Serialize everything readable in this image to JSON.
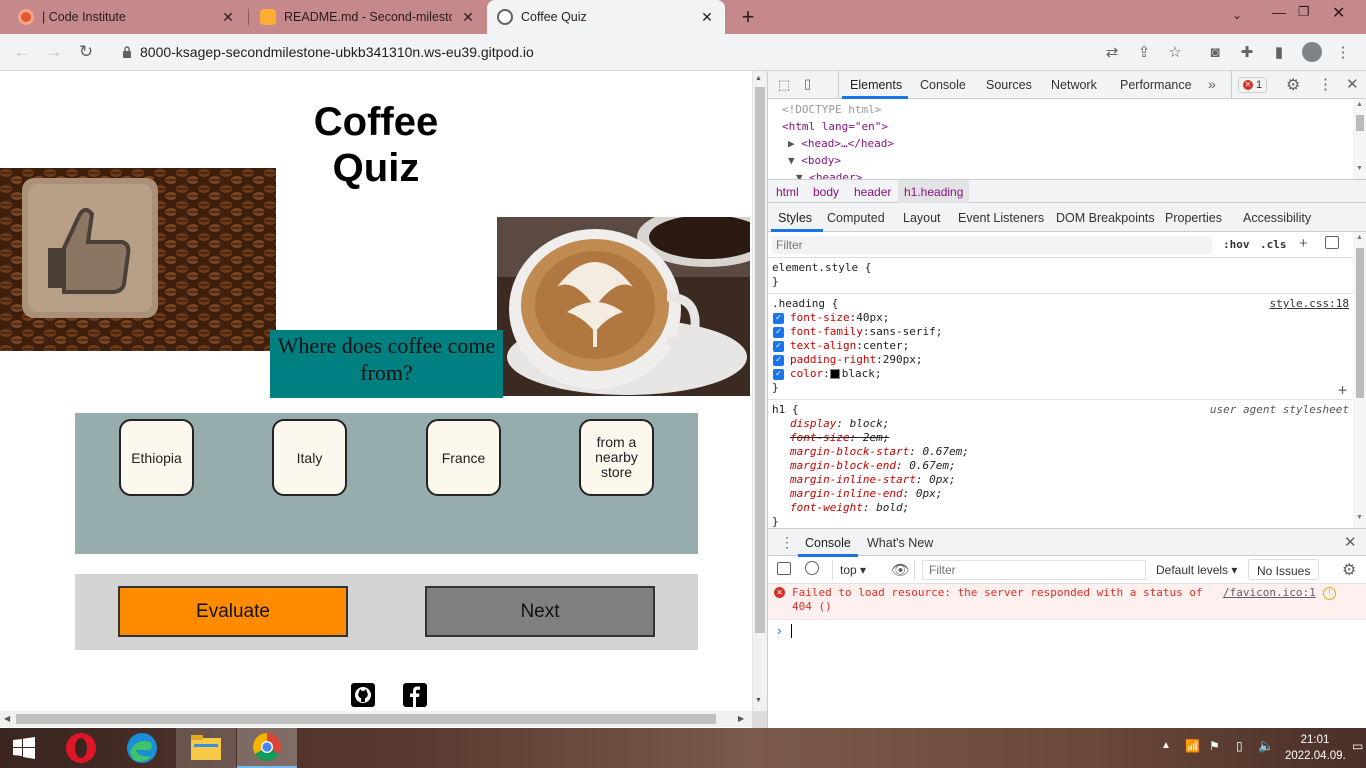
{
  "browser": {
    "tabs": [
      {
        "title": "| Code Institute",
        "active": false
      },
      {
        "title": "README.md - Second-milestone",
        "active": false
      },
      {
        "title": "Coffee Quiz",
        "active": true
      }
    ],
    "new_tab": "+",
    "url": "8000-ksagep-secondmilestone-ubkb341310n.ws-eu39.gitpod.io"
  },
  "quiz": {
    "heading_line1": "Coffee",
    "heading_line2": "Quiz",
    "question": "Where does coffee come from?",
    "answers": [
      "Ethiopia",
      "Italy",
      "France",
      "from a nearby store"
    ],
    "evaluate_label": "Evaluate",
    "next_label": "Next",
    "colors": {
      "question_bg": "#008080",
      "answers_bg": "#97acad",
      "evaluate_bg": "#ff8c00",
      "next_bg": "#808080",
      "controls_bg": "#d3d3d3"
    }
  },
  "devtools": {
    "main_tabs": [
      "Elements",
      "Console",
      "Sources",
      "Network",
      "Performance"
    ],
    "more_tabs": "»",
    "error_count": "1",
    "dom_lines": [
      "<!DOCTYPE html>",
      "<html lang=\"en\">",
      "<head>…</head>",
      "<body>",
      "<header>"
    ],
    "breadcrumbs": [
      "html",
      "body",
      "header",
      "h1.heading"
    ],
    "style_tabs": [
      "Styles",
      "Computed",
      "Layout",
      "Event Listeners",
      "DOM Breakpoints",
      "Properties",
      "Accessibility"
    ],
    "filter_placeholder": "Filter",
    "hov": ":hov",
    "cls": ".cls",
    "element_style_open": "element.style {",
    "close_brace": "}",
    "heading_rule": {
      "selector": ".heading {",
      "source": "style.css:18",
      "props": [
        {
          "name": "font-size",
          "value": "40px;"
        },
        {
          "name": "font-family",
          "value": "sans-serif;"
        },
        {
          "name": "text-align",
          "value": "center;"
        },
        {
          "name": "padding-right",
          "value": "290px;"
        },
        {
          "name": "color",
          "value": "black;"
        }
      ]
    },
    "h1_rule": {
      "selector": "h1 {",
      "source": "user agent stylesheet",
      "props": [
        {
          "name": "display",
          "value": "block;",
          "struck": false
        },
        {
          "name": "font-size",
          "value": "2em;",
          "struck": true
        },
        {
          "name": "margin-block-start",
          "value": "0.67em;",
          "struck": false
        },
        {
          "name": "margin-block-end",
          "value": "0.67em;",
          "struck": false
        },
        {
          "name": "margin-inline-start",
          "value": "0px;",
          "struck": false
        },
        {
          "name": "margin-inline-end",
          "value": "0px;",
          "struck": false
        },
        {
          "name": "font-weight",
          "value": "bold;",
          "struck": false
        }
      ]
    },
    "drawer_tabs": [
      "Console",
      "What's New"
    ],
    "console": {
      "context": "top",
      "filter_placeholder": "Filter",
      "levels": "Default levels",
      "issues": "No Issues",
      "error_message": "Failed to load resource: the server responded with a status of 404 ()",
      "error_source": "/favicon.ico:1",
      "prompt": "›"
    }
  },
  "taskbar": {
    "time": "21:01",
    "date": "2022.04.09."
  }
}
